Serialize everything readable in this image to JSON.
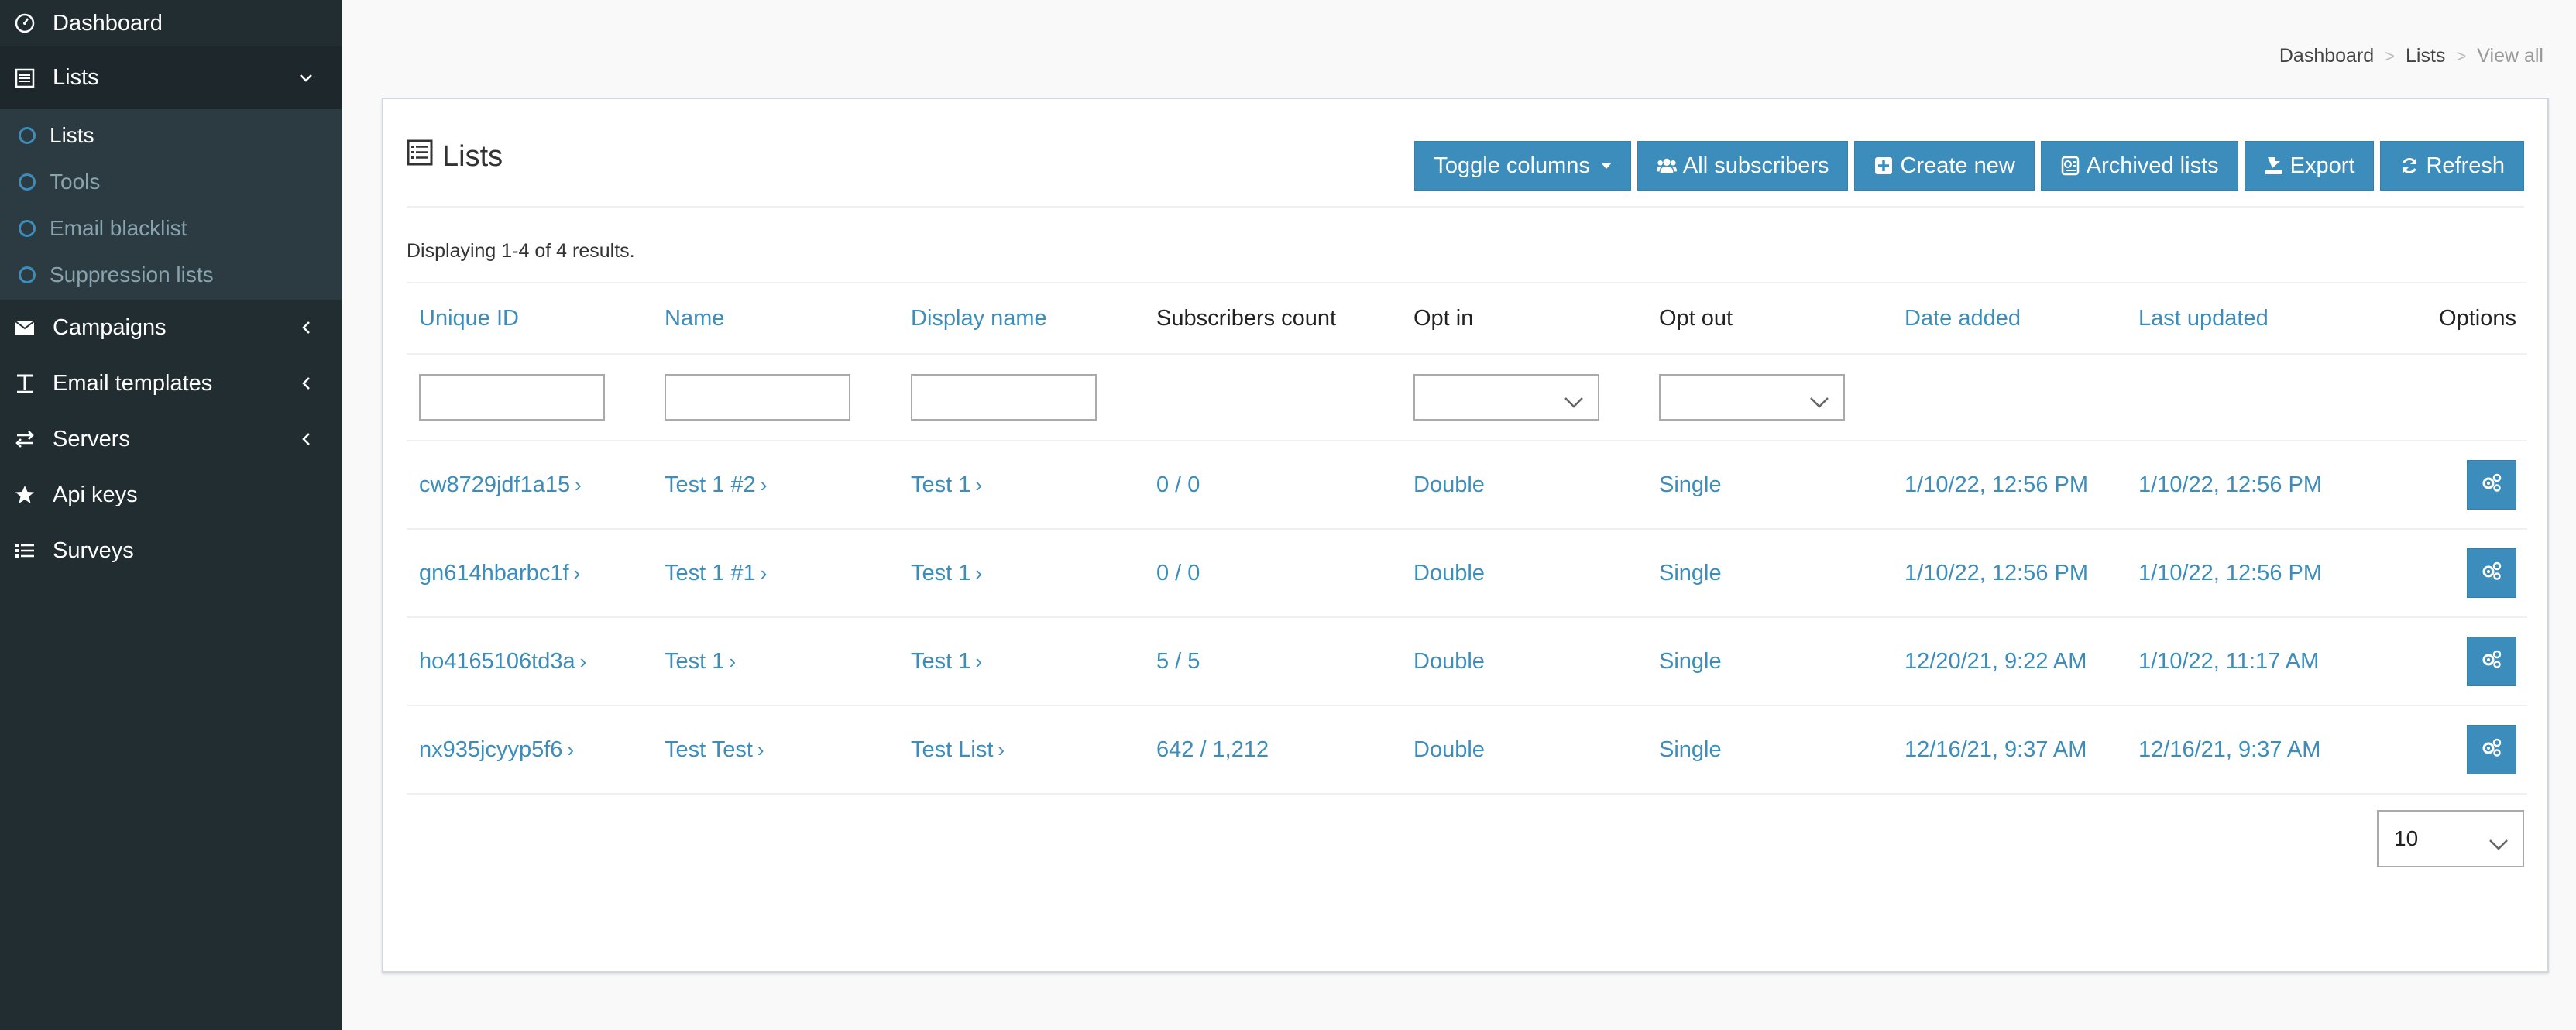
{
  "sidebar": {
    "dashboard": "Dashboard",
    "lists": "Lists",
    "sub": [
      "Lists",
      "Tools",
      "Email blacklist",
      "Suppression lists"
    ],
    "campaigns": "Campaigns",
    "email_templates": "Email templates",
    "servers": "Servers",
    "api_keys": "Api keys",
    "surveys": "Surveys"
  },
  "breadcrumb": {
    "dashboard": "Dashboard",
    "lists": "Lists",
    "current": "View all",
    "sep": ">"
  },
  "box": {
    "title": "Lists",
    "buttons": {
      "toggle": "Toggle columns",
      "all_subscribers": "All subscribers",
      "create_new": "Create new",
      "archived": "Archived lists",
      "export": "Export",
      "refresh": "Refresh"
    },
    "summary": "Displaying 1-4 of 4 results."
  },
  "table": {
    "headers": [
      "Unique ID",
      "Name",
      "Display name",
      "Subscribers count",
      "Opt in",
      "Opt out",
      "Date added",
      "Last updated",
      "Options"
    ],
    "rows": [
      {
        "uid": "cw8729jdf1a15",
        "name": "Test 1 #2",
        "display": "Test 1",
        "subs": "0 / 0",
        "optin": "Double",
        "optout": "Single",
        "added": "1/10/22, 12:56 PM",
        "updated": "1/10/22, 12:56 PM"
      },
      {
        "uid": "gn614hbarbc1f",
        "name": "Test 1 #1",
        "display": "Test 1",
        "subs": "0 / 0",
        "optin": "Double",
        "optout": "Single",
        "added": "1/10/22, 12:56 PM",
        "updated": "1/10/22, 12:56 PM"
      },
      {
        "uid": "ho4165106td3a",
        "name": "Test 1",
        "display": "Test 1",
        "subs": "5 / 5",
        "optin": "Double",
        "optout": "Single",
        "added": "12/20/21, 9:22 AM",
        "updated": "1/10/22, 11:17 AM"
      },
      {
        "uid": "nx935jcyyp5f6",
        "name": "Test Test",
        "display": "Test List",
        "subs": "642 / 1,212",
        "optin": "Double",
        "optout": "Single",
        "added": "12/16/21, 9:37 AM",
        "updated": "12/16/21, 9:37 AM"
      }
    ],
    "chevron": "›"
  },
  "pager": {
    "page_size": "10"
  },
  "colors": {
    "sidebar_bg": "#222d32",
    "accent": "#3c8dbc"
  }
}
